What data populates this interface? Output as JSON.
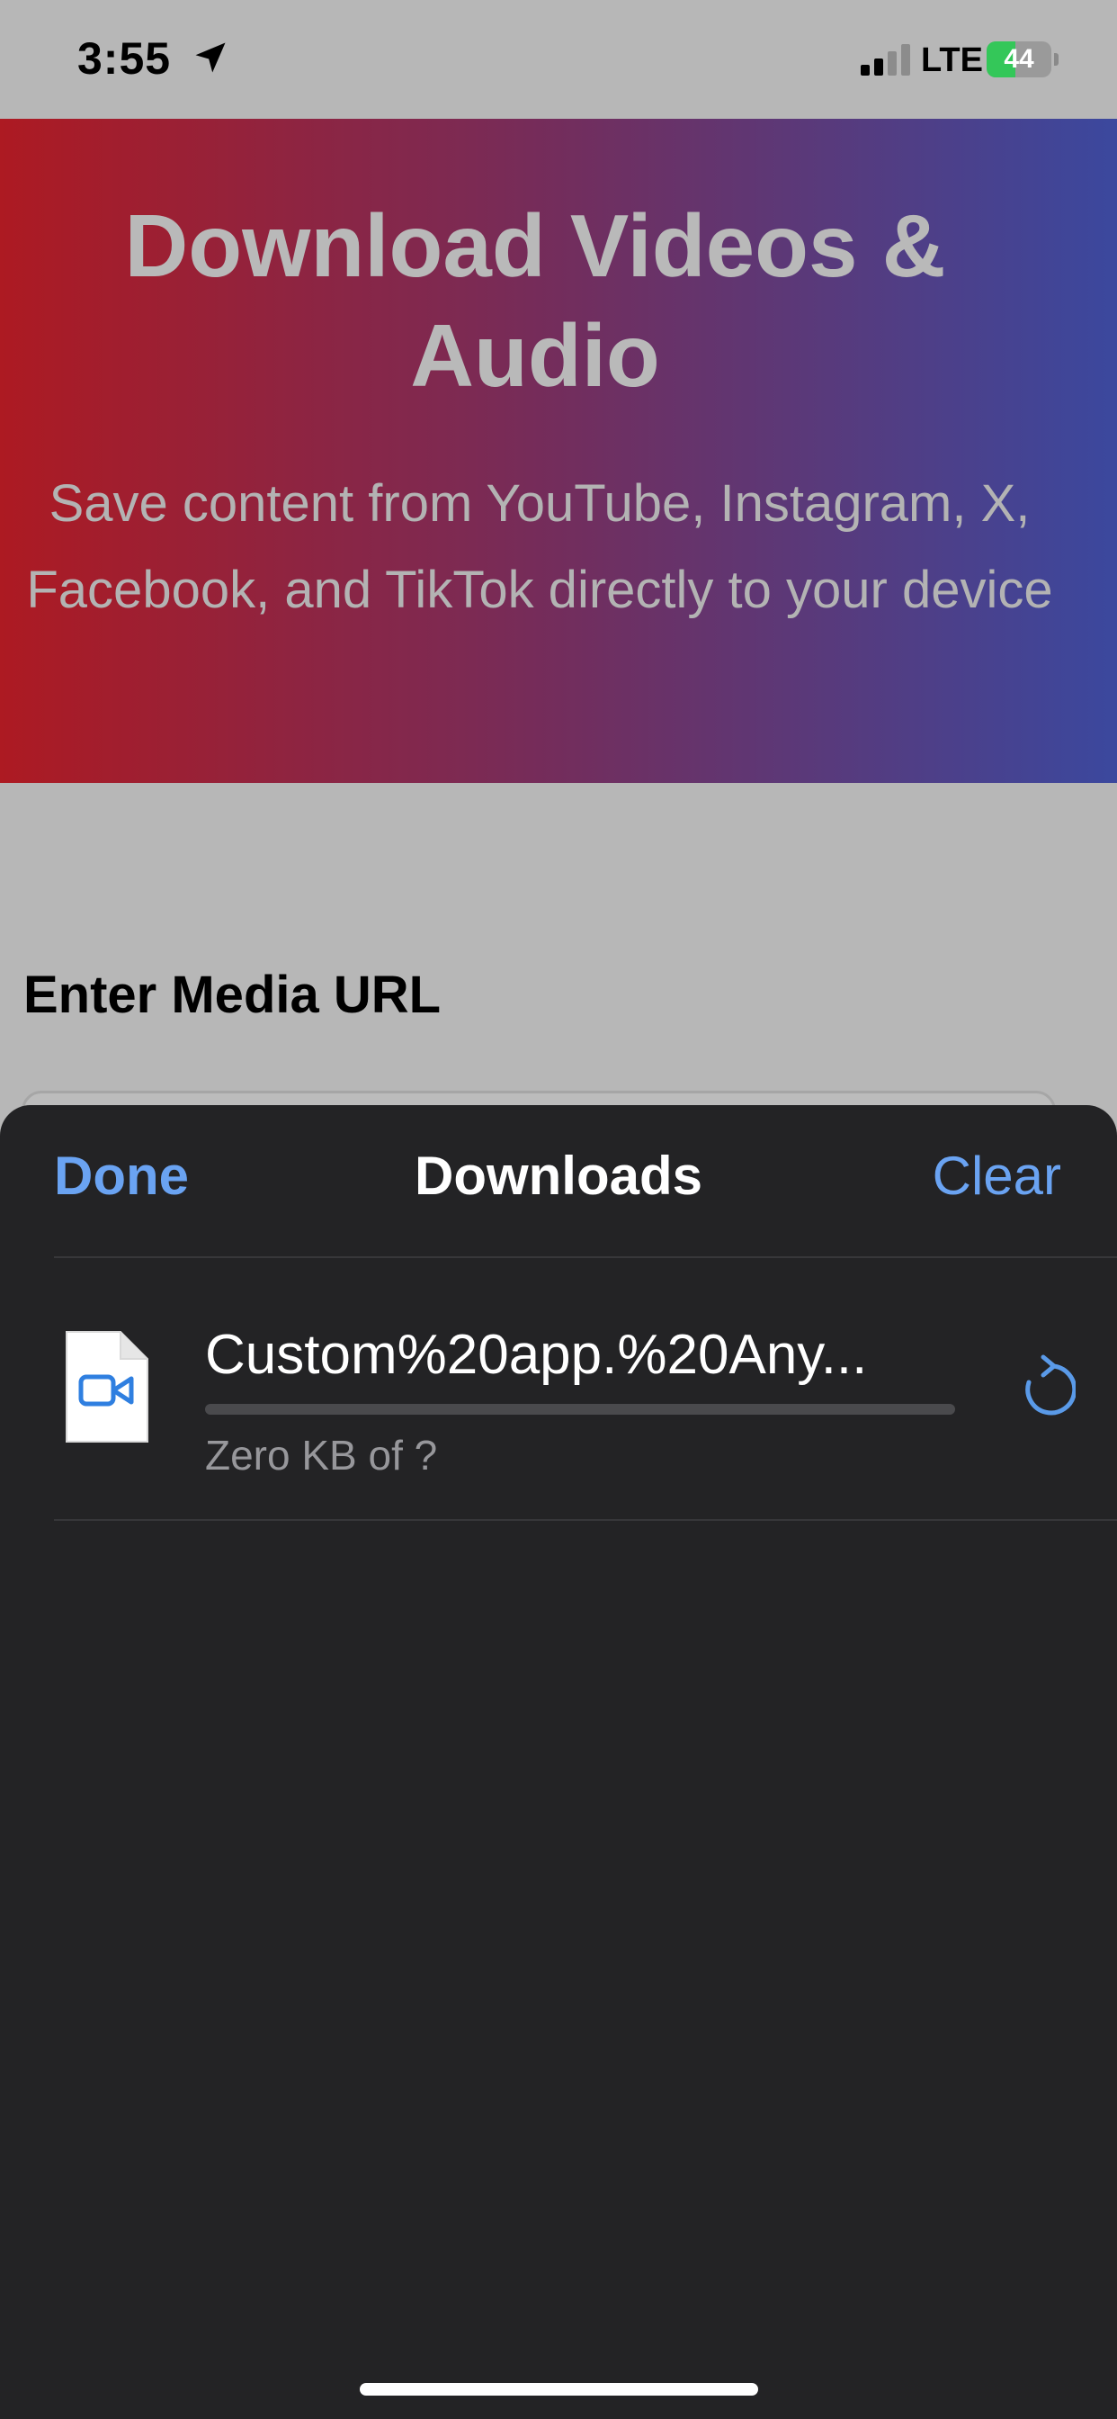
{
  "status_bar": {
    "time": "3:55",
    "network": "LTE",
    "battery_level": "44",
    "battery_fraction": 0.44,
    "icons": [
      "location-arrow-icon",
      "signal-bars-icon",
      "battery-charging-icon"
    ]
  },
  "hero": {
    "title": "Download Videos & Audio",
    "subtitle": "Save content from YouTube, Instagram, X, Facebook, and TikTok directly to your device"
  },
  "form": {
    "url_heading": "Enter Media URL"
  },
  "downloads_sheet": {
    "done_label": "Done",
    "title": "Downloads",
    "clear_label": "Clear",
    "items": [
      {
        "file_name": "Custom%20app.%20Any...",
        "size_text": "Zero KB of ?",
        "progress": 0,
        "file_icon": "video-file-icon",
        "action_icon": "retry-icon"
      }
    ]
  },
  "colors": {
    "accent": "#6aa3f2",
    "sheet_background": "#232325",
    "hero_gradient_start": "#ad1a22",
    "hero_gradient_end": "#3b489e",
    "battery_green": "#34c759"
  }
}
